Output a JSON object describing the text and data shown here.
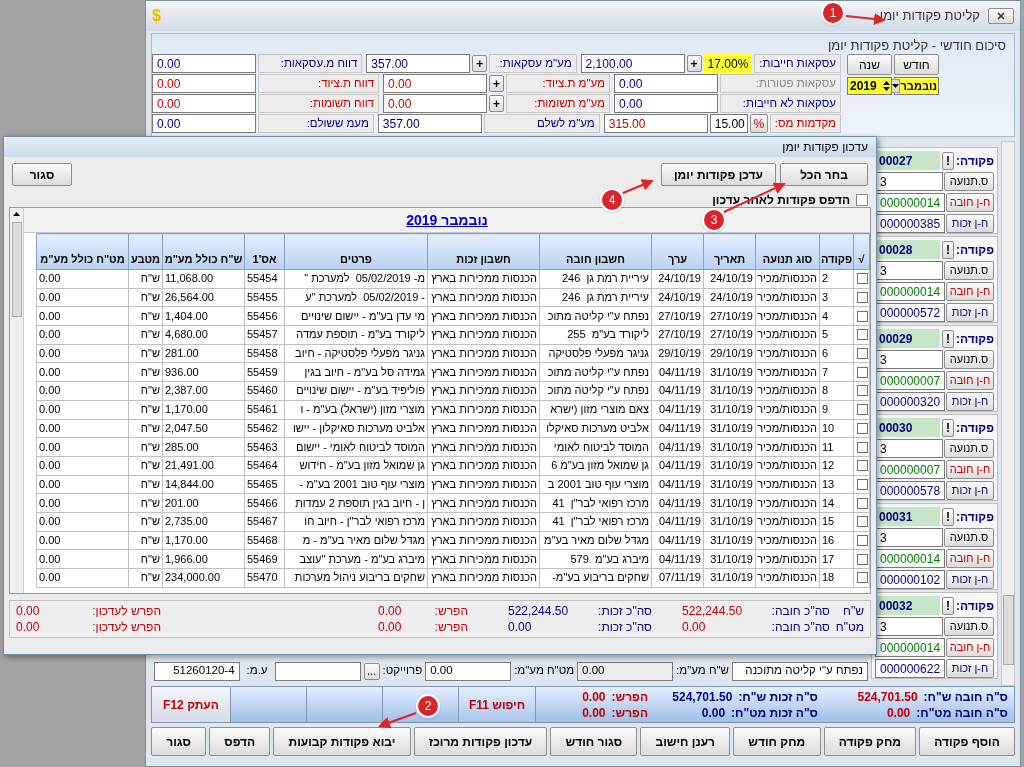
{
  "window": {
    "title": "קליטת פקודות יומן",
    "app_icon": "$"
  },
  "summary": {
    "title": "סיכום חודשי - קליטת פקודות יומן",
    "month_button": "חודש",
    "year_button": "שנה",
    "month": "נובמבר",
    "year": "2019",
    "rows": [
      [
        {
          "label": {
            "text": "עסקאות חייבות:",
            "color": "#000080"
          },
          "rate": "17.00%",
          "button": "+",
          "value": "2,100.00",
          "color": "#000080"
        },
        {
          "label": {
            "text": "מע\"מ עסקאות:",
            "color": "#000080"
          },
          "button": "+",
          "value": "357.00",
          "color": "#000080"
        },
        {
          "label": {
            "text": "דווח מ.עסקאות:",
            "color": "#000080"
          },
          "value": "0.00",
          "color": "#000080"
        }
      ],
      [
        {
          "label": {
            "text": "עסקאות פטורות:",
            "color": "#8a8a8a"
          },
          "value": "0.00",
          "color": "#000080"
        },
        {
          "label": {
            "text": "מע\"מ ת.ציוד:",
            "color": "#c00000"
          },
          "button": "+",
          "value": "0.00",
          "color": "#c00000"
        },
        {
          "label": {
            "text": "דווח ת.ציוד:",
            "color": "#c00000"
          },
          "value": "0.00",
          "color": "#c00000"
        }
      ],
      [
        {
          "label": {
            "text": "עסקאות לא חייבות:",
            "color": "#000080"
          },
          "value": "0.00",
          "color": "#000080"
        },
        {
          "label": {
            "text": "מע\"מ תשומות:",
            "color": "#c00000"
          },
          "button": "+",
          "value": "0.00",
          "color": "#c00000"
        },
        {
          "label": {
            "text": "דווח תשומות:",
            "color": "#c00000"
          },
          "value": "0.00",
          "color": "#c00000"
        }
      ],
      [
        {
          "label": {
            "text": "מקדמות מס:",
            "color": "#c00000"
          },
          "button": "%",
          "rate": "15.00",
          "value": "315.00",
          "color": "#c00000"
        },
        {
          "label": {
            "text": "מע\"מ לשלם",
            "color": "#000080"
          },
          "value": "357.00",
          "color": "#000080"
        },
        {
          "label": {
            "text": "מעמ ששולם:",
            "color": "#000080"
          },
          "value": "0.00",
          "color": "#000080"
        }
      ]
    ]
  },
  "entries": [
    {
      "label": "פקודה:",
      "alert": "!",
      "number": "00027",
      "fields": [
        {
          "label": {
            "text": "ס.תנועה",
            "color": "#000000"
          },
          "value": "3",
          "color": "#000000"
        },
        {
          "label": {
            "text": "ח-ן חובה",
            "color": "#c00000"
          },
          "value": "000000014",
          "color": "#008000"
        },
        {
          "label": {
            "text": "ח-ן זכות",
            "color": "#000080"
          },
          "value": "000000385",
          "color": "#000080"
        }
      ]
    },
    {
      "label": "פקודה:",
      "alert": "!",
      "number": "00028",
      "fields": [
        {
          "label": {
            "text": "ס.תנועה",
            "color": "#000000"
          },
          "value": "3",
          "color": "#000000"
        },
        {
          "label": {
            "text": "ח-ן חובה",
            "color": "#c00000"
          },
          "value": "000000014",
          "color": "#008000"
        },
        {
          "label": {
            "text": "ח-ן זכות",
            "color": "#000080"
          },
          "value": "000000572",
          "color": "#000080"
        }
      ]
    },
    {
      "label": "פקודה:",
      "alert": "!",
      "number": "00029",
      "fields": [
        {
          "label": {
            "text": "ס.תנועה",
            "color": "#000000"
          },
          "value": "3",
          "color": "#000000"
        },
        {
          "label": {
            "text": "ח-ן חובה",
            "color": "#c00000"
          },
          "value": "000000007",
          "color": "#008000"
        },
        {
          "label": {
            "text": "ח-ן זכות",
            "color": "#000080"
          },
          "value": "000000320",
          "color": "#000080"
        }
      ]
    },
    {
      "label": "פקודה:",
      "alert": "!",
      "number": "00030",
      "fields": [
        {
          "label": {
            "text": "ס.תנועה",
            "color": "#000000"
          },
          "value": "3",
          "color": "#000000"
        },
        {
          "label": {
            "text": "ח-ן חובה",
            "color": "#c00000"
          },
          "value": "000000007",
          "color": "#008000"
        },
        {
          "label": {
            "text": "ח-ן זכות",
            "color": "#000080"
          },
          "value": "000000578",
          "color": "#000080"
        }
      ]
    },
    {
      "label": "פקודה:",
      "alert": "!",
      "number": "00031",
      "fields": [
        {
          "label": {
            "text": "ס.תנועה",
            "color": "#000000"
          },
          "value": "3",
          "color": "#000000"
        },
        {
          "label": {
            "text": "ח-ן חובה",
            "color": "#c00000"
          },
          "value": "000000014",
          "color": "#008000"
        },
        {
          "label": {
            "text": "ח-ן זכות",
            "color": "#000080"
          },
          "value": "000000102",
          "color": "#000080"
        }
      ]
    },
    {
      "label": "פקודה:",
      "alert": "!",
      "number": "00032",
      "fields": [
        {
          "label": {
            "text": "ס.תנועה",
            "color": "#000000"
          },
          "value": "3",
          "color": "#000000"
        },
        {
          "label": {
            "text": "ח-ן חובה",
            "color": "#c00000"
          },
          "value": "000000014",
          "color": "#008000"
        },
        {
          "label": {
            "text": "ח-ן זכות",
            "color": "#000080"
          },
          "value": "000000622",
          "color": "#000080"
        }
      ]
    }
  ],
  "entry_row": {
    "description": "נפתח ע\"י קליטה מתוכנה",
    "vat_ils_label": "ש\"ח מע\"מ:",
    "vat_ils": "0.00",
    "vat_fx_label": "מט\"ח מע\"מ:",
    "vat_fx": "0.00",
    "project_label": "פרוייקט:",
    "project_button": "...",
    "tax_id_label": "ע.מ:",
    "tax_id": "51260120-4"
  },
  "totals": [
    [
      {
        "label": "ס\"ה חובה ש\"ח:",
        "value": "524,701.50",
        "color": "#c00000"
      },
      {
        "label": "ס\"ה זכות ש\"ח:",
        "value": "524,701.50",
        "color": "#000080"
      },
      {
        "label": "הפרש:",
        "value": "0.00",
        "color": "#c00000"
      }
    ],
    [
      {
        "label": "ס\"ה חובה מט\"ח:",
        "value": "0.00",
        "color": "#c00000"
      },
      {
        "label": "ס\"ה זכות מט\"ח:",
        "value": "0.00",
        "color": "#000080"
      },
      {
        "label": "הפרש:",
        "value": "0.00",
        "color": "#c00000"
      }
    ]
  ],
  "search_button": "חיפוש F11",
  "copy_button": "העתק F12",
  "buttons": [
    "הוסף פקודה",
    "מחק פקודה",
    "מחק חודש",
    "רענן חישוב",
    "סגור חודש",
    "עדכון פקודות מרוכז",
    "יבוא פקודות קבועות",
    "הדפס",
    "סגור"
  ],
  "dialog": {
    "title": "עדכון פקודות יומן",
    "select_all": "בחר הכל",
    "update": "עדכן פקודות יומן",
    "close": "סגור",
    "print_after": {
      "label": "הדפס פקודות לאחר עדכון",
      "checked": false
    },
    "caption": "נובמבר 2019",
    "check_column": "√",
    "columns": [
      "פקודה",
      "סוג תנועה",
      "תאריך",
      "ערך",
      "חשבון חובה",
      "חשבון זכות",
      "פרטים",
      "אס'1",
      "ש\"ח כולל מע\"מ",
      "מטבע",
      "מט\"ח כולל מע\"מ"
    ],
    "rows": [
      {
        "checked": false,
        "cells": [
          "2",
          "הכנסות/מכיר",
          "24/10/19",
          "24/10/19",
          "עיריית רמת גן  246",
          "הכנסות ממכירות בארץ",
          "מ- 05/02/2019  למערכת \"",
          "55454",
          "11,068.00",
          "ש\"ח",
          "0.00"
        ]
      },
      {
        "checked": false,
        "cells": [
          "3",
          "הכנסות/מכיר",
          "24/10/19",
          "24/10/19",
          "עיריית רמת גן  246",
          "הכנסות ממכירות בארץ",
          "- 05/02/2019  למערכת \"ע",
          "55455",
          "26,564.00",
          "ש\"ח",
          "0.00"
        ]
      },
      {
        "checked": false,
        "cells": [
          "4",
          "הכנסות/מכיר",
          "27/10/19",
          "27/10/19",
          "נפתח ע\"י קליטה מתוכ",
          "הכנסות ממכירות בארץ",
          "מי עדן בע\"מ - יישום שינויים",
          "55456",
          "1,404.00",
          "ש\"ח",
          "0.00"
        ]
      },
      {
        "checked": false,
        "cells": [
          "5",
          "הכנסות/מכיר",
          "27/10/19",
          "27/10/19",
          "ליקורד בע\"מ  255",
          "הכנסות ממכירות בארץ",
          "ליקורד בע\"מ - תוספת עמדה",
          "55457",
          "4,680.00",
          "ש\"ח",
          "0.00"
        ]
      },
      {
        "checked": false,
        "cells": [
          "6",
          "הכנסות/מכיר",
          "29/10/19",
          "29/10/19",
          "גניגר מפעלי פלסטיקה",
          "הכנסות ממכירות בארץ",
          "גניגר מפעלי פלסטיקה - חיוב",
          "55458",
          "281.00",
          "ש\"ח",
          "0.00"
        ]
      },
      {
        "checked": false,
        "cells": [
          "7",
          "הכנסות/מכיר",
          "31/10/19",
          "04/11/19",
          "נפתח ע\"י קליטה מתוכ",
          "הכנסות ממכירות בארץ",
          "גמידה סל בע\"מ - חיוב בגין",
          "55459",
          "936.00",
          "ש\"ח",
          "0.00"
        ]
      },
      {
        "checked": false,
        "cells": [
          "8",
          "הכנסות/מכיר",
          "31/10/19",
          "04/11/19",
          "נפתח ע\"י קליטה מתוכ",
          "הכנסות ממכירות בארץ",
          "פוליפיד בע\"מ - יישום שינויים",
          "55460",
          "2,387.00",
          "ש\"ח",
          "0.00"
        ]
      },
      {
        "checked": false,
        "cells": [
          "9",
          "הכנסות/מכיר",
          "31/10/19",
          "04/11/19",
          "צאם מוצרי מזון (ישרא",
          "הכנסות ממכירות בארץ",
          "מוצרי מזון (ישראל) בע\"מ - ו",
          "55461",
          "1,170.00",
          "ש\"ח",
          "0.00"
        ]
      },
      {
        "checked": false,
        "cells": [
          "10",
          "הכנסות/מכיר",
          "31/10/19",
          "04/11/19",
          "אלביט מערכות סאיקלו",
          "הכנסות ממכירות בארץ",
          "אלביט מערכות סאיקלון - יישו",
          "55462",
          "2,047.50",
          "ש\"ח",
          "0.00"
        ]
      },
      {
        "checked": false,
        "cells": [
          "11",
          "הכנסות/מכיר",
          "31/10/19",
          "04/11/19",
          "המוסד לביטוח לאומי",
          "הכנסות ממכירות בארץ",
          "המוסד לביטוח לאומי - יישום",
          "55463",
          "285.00",
          "ש\"ח",
          "0.00"
        ]
      },
      {
        "checked": false,
        "cells": [
          "12",
          "הכנסות/מכיר",
          "31/10/19",
          "04/11/19",
          "גן שמואל מזון בע\"מ 6",
          "הכנסות ממכירות בארץ",
          "גן שמואל מזון בע\"מ - חידוש",
          "55464",
          "21,491.00",
          "ש\"ח",
          "0.00"
        ]
      },
      {
        "checked": false,
        "cells": [
          "13",
          "הכנסות/מכיר",
          "31/10/19",
          "04/11/19",
          "מוצרי עוף טוב 2001 ב",
          "הכנסות ממכירות בארץ",
          "מוצרי עוף טוב 2001 בע\"מ -",
          "55465",
          "14,844.00",
          "ש\"ח",
          "0.00"
        ]
      },
      {
        "checked": false,
        "cells": [
          "14",
          "הכנסות/מכיר",
          "31/10/19",
          "04/11/19",
          "מרכז רפואי לבר\"ן  41",
          "הכנסות ממכירות בארץ",
          "ן - חיוב בגין תוספת 2 עמדות",
          "55466",
          "201.00",
          "ש\"ח",
          "0.00"
        ]
      },
      {
        "checked": false,
        "cells": [
          "15",
          "הכנסות/מכיר",
          "31/10/19",
          "04/11/19",
          "מרכז רפואי לבר\"ן  41",
          "הכנסות ממכירות בארץ",
          "מרכז רפואי לבר\"ן - חיוב חו",
          "55467",
          "2,735.00",
          "ש\"ח",
          "0.00"
        ]
      },
      {
        "checked": false,
        "cells": [
          "16",
          "הכנסות/מכיר",
          "31/10/19",
          "04/11/19",
          "מגדל שלום מאיר בע\"מ",
          "הכנסות ממכירות בארץ",
          "מגדל שלום מאיר בע\"מ - מ",
          "55468",
          "1,170.00",
          "ש\"ח",
          "0.00"
        ]
      },
      {
        "checked": false,
        "cells": [
          "17",
          "הכנסות/מכיר",
          "31/10/19",
          "04/11/19",
          "מיברג בע\"מ  579",
          "הכנסות ממכירות בארץ",
          "מיברג בע\"מ - מערכת \"עוצב",
          "55469",
          "1,966.00",
          "ש\"ח",
          "0.00"
        ]
      },
      {
        "checked": false,
        "cells": [
          "18",
          "הכנסות/מכיר",
          "31/10/19",
          "07/11/19",
          "שחקים בריבוע בע\"מ-",
          "הכנסות ממכירות בארץ",
          "שחקים בריבוע ניהול מערכות",
          "55470",
          "234,000.00",
          "ש\"ח",
          "0.00"
        ]
      }
    ],
    "footer": [
      {
        "currency": "ש\"ח",
        "debit_label": "סה\"כ חובה:",
        "debit": "522,244.50",
        "credit_label": "סה\"כ זכות:",
        "credit": "522,244.50",
        "diff_label": "הפרש:",
        "diff": "0.00",
        "pending_label": "הפרש לעדכון:",
        "pending": "0.00"
      },
      {
        "currency": "מט\"ח",
        "debit_label": "סה\"כ חובה:",
        "debit": "0.00",
        "credit_label": "סה\"כ זכות:",
        "credit": "0.00",
        "diff_label": "הפרש:",
        "diff": "0.00",
        "pending_label": "הפרש לעדכון:",
        "pending": "0.00"
      }
    ]
  },
  "annotations": [
    {
      "number": "1"
    },
    {
      "number": "2"
    },
    {
      "number": "3"
    },
    {
      "number": "4"
    }
  ]
}
